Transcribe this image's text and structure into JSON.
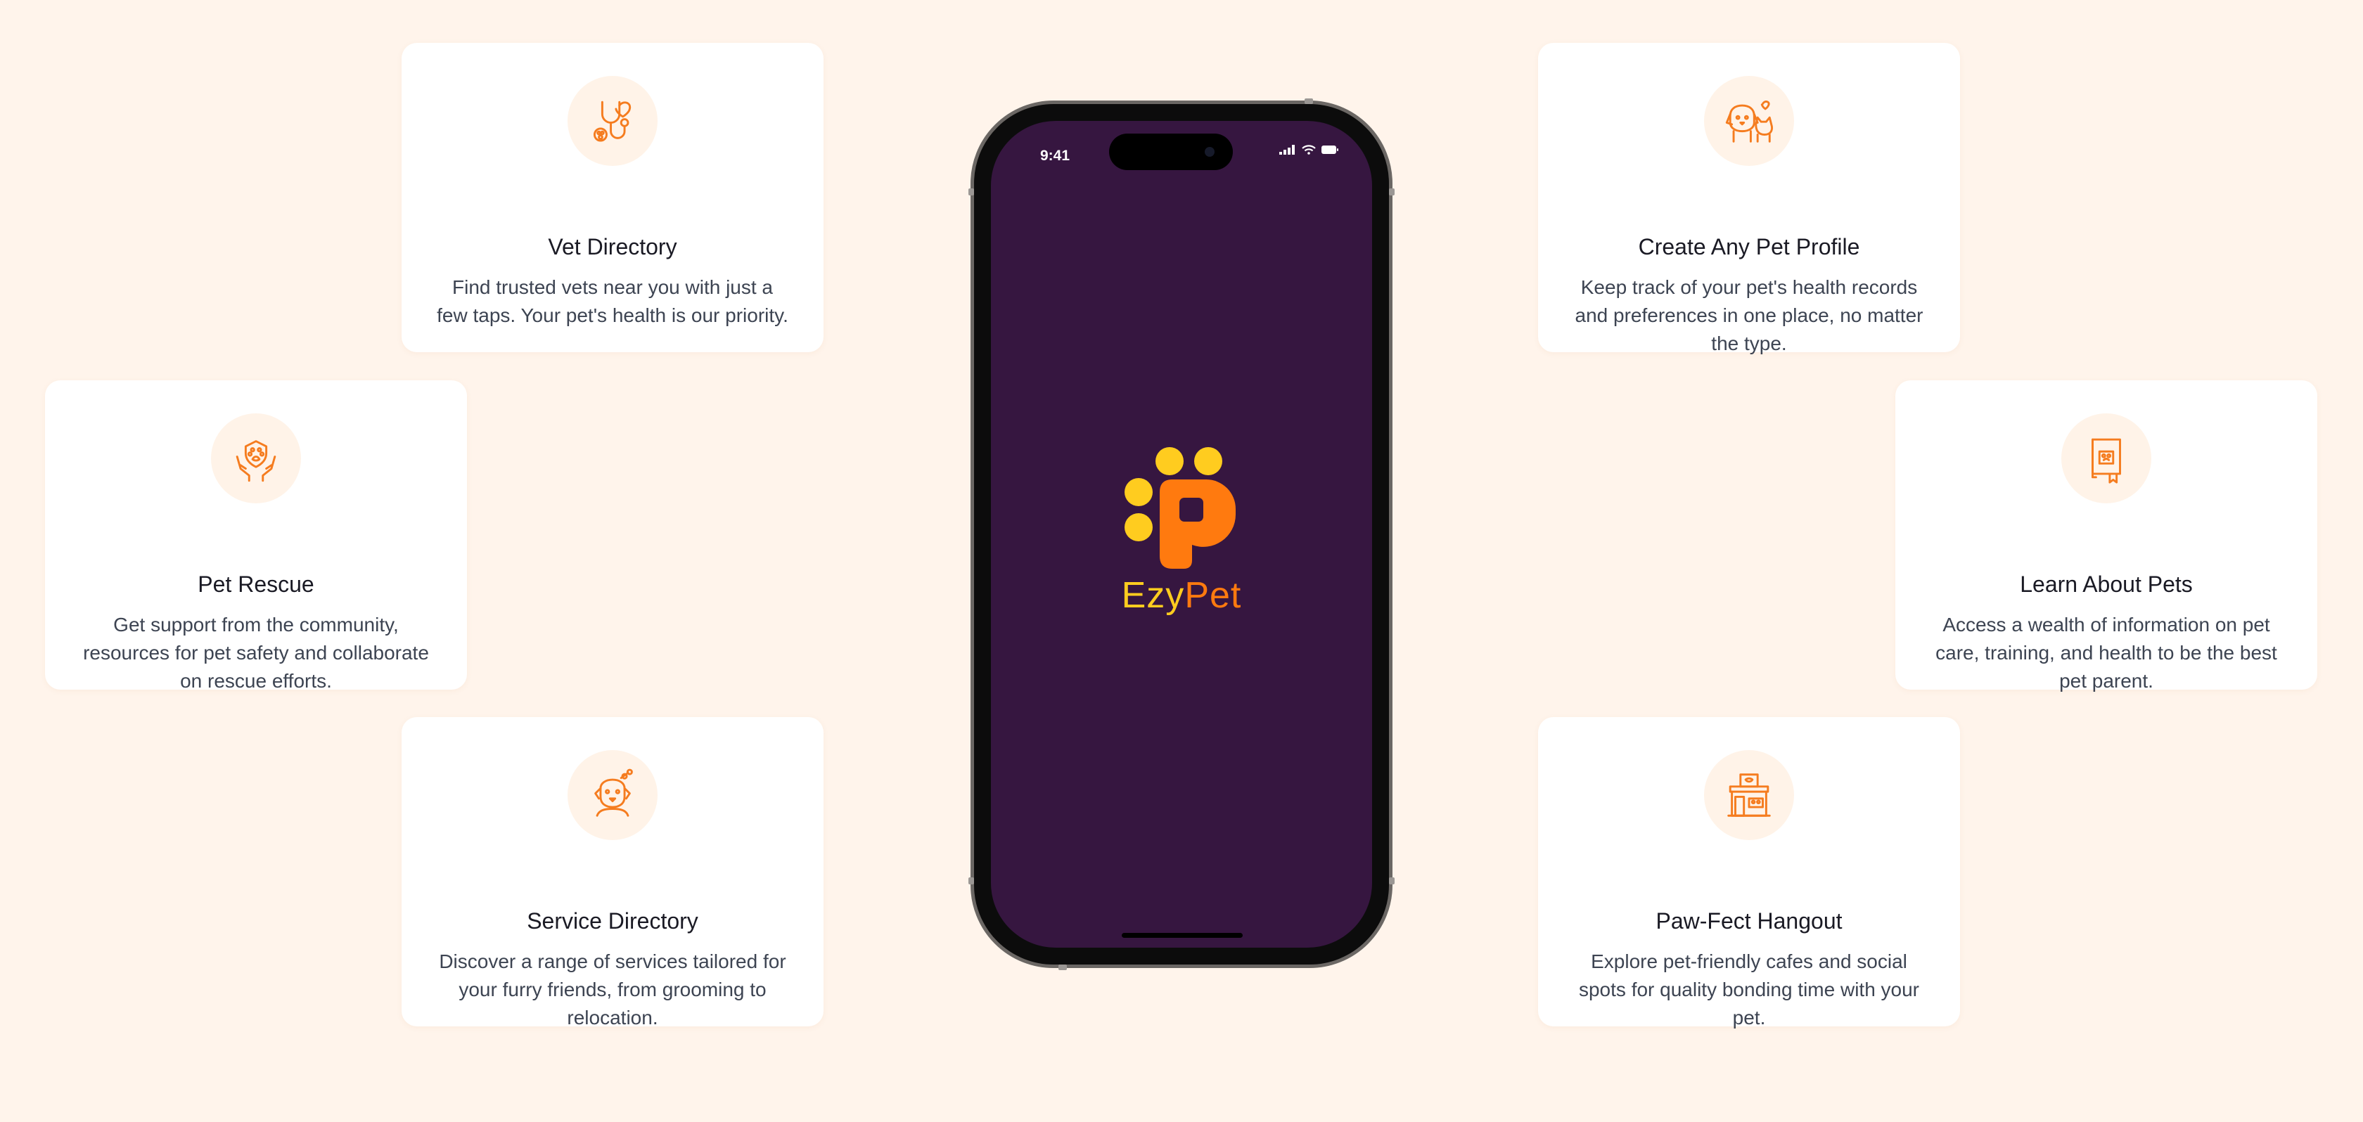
{
  "features": {
    "vet_directory": {
      "icon": "vet-stethoscope-icon",
      "title": "Vet Directory",
      "description": "Find trusted vets near you with just a few taps. Your pet's health is our priority."
    },
    "pet_rescue": {
      "icon": "rescue-hands-icon",
      "title": "Pet Rescue",
      "description": "Get support from the community, resources for pet safety and collaborate on rescue efforts."
    },
    "service_directory": {
      "icon": "grooming-dog-icon",
      "title": "Service Directory",
      "description": "Discover a range of services tailored for your furry friends, from grooming to relocation."
    },
    "create_pet_profile": {
      "icon": "pets-dog-cat-icon",
      "title": "Create Any Pet Profile",
      "description": "Keep track of your pet's health records and preferences in one place, no matter the type."
    },
    "learn_about_pets": {
      "icon": "pet-book-icon",
      "title": "Learn About Pets",
      "description": "Access a wealth of information on pet care, training, and health to be the best pet parent."
    },
    "pawfect_hangout": {
      "icon": "pet-cafe-shop-icon",
      "title": "Paw-Fect Hangout",
      "description": "Explore pet-friendly cafes and social spots for quality bonding time with your pet."
    }
  },
  "phone": {
    "status_time": "9:41",
    "app_name_part1": "Ezy",
    "app_name_part2": "Pet"
  },
  "colors": {
    "background": "#fff4eb",
    "accent": "#f57c1f",
    "screen": "#361640",
    "logo_yellow": "#ffcc1f",
    "logo_orange": "#ff7a0f"
  }
}
